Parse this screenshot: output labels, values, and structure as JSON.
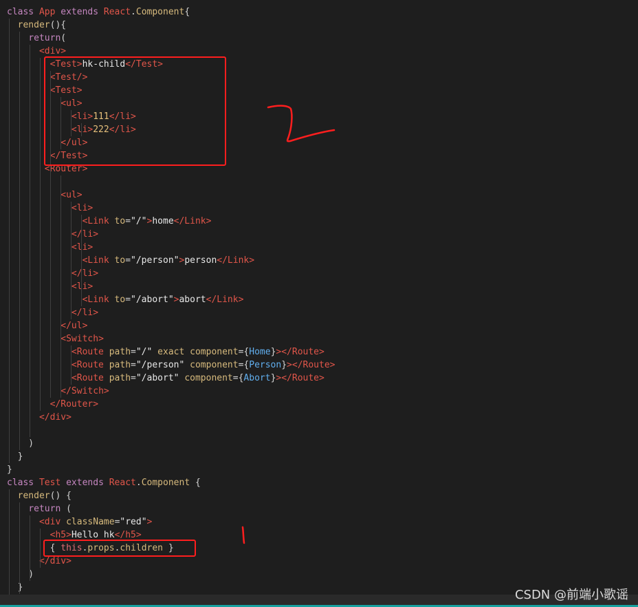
{
  "editor": {
    "language": "jsx",
    "lines": [
      [
        [
          "kw",
          "class "
        ],
        [
          "cls",
          "App "
        ],
        [
          "kw",
          "extends "
        ],
        [
          "cls",
          "React"
        ],
        [
          "br",
          "."
        ],
        [
          "fn",
          "Component"
        ],
        [
          "br",
          "{"
        ]
      ],
      [
        [
          "br",
          "  "
        ],
        [
          "fn",
          "render"
        ],
        [
          "br",
          "(){"
        ]
      ],
      [
        [
          "br",
          "    "
        ],
        [
          "kw",
          "return"
        ],
        [
          "br",
          "("
        ]
      ],
      [
        [
          "br",
          "      "
        ],
        [
          "tag",
          "<div>"
        ]
      ],
      [
        [
          "br",
          "        "
        ],
        [
          "tag",
          "<Test>"
        ],
        [
          "txt",
          "hk-child"
        ],
        [
          "tag",
          "</Test>"
        ]
      ],
      [
        [
          "br",
          "        "
        ],
        [
          "tag",
          "<Test/>"
        ]
      ],
      [
        [
          "br",
          "        "
        ],
        [
          "tag",
          "<Test>"
        ]
      ],
      [
        [
          "br",
          "          "
        ],
        [
          "tag",
          "<ul>"
        ]
      ],
      [
        [
          "br",
          "            "
        ],
        [
          "tag",
          "<li>"
        ],
        [
          "num",
          "111"
        ],
        [
          "tag",
          "</li>"
        ]
      ],
      [
        [
          "br",
          "            "
        ],
        [
          "tag",
          "<li>"
        ],
        [
          "num",
          "222"
        ],
        [
          "tag",
          "</li>"
        ]
      ],
      [
        [
          "br",
          "          "
        ],
        [
          "tag",
          "</ul>"
        ]
      ],
      [
        [
          "br",
          "        "
        ],
        [
          "tag",
          "</Test>"
        ]
      ],
      [
        [
          "br",
          "       "
        ],
        [
          "tag",
          "<Router>"
        ]
      ],
      [],
      [
        [
          "br",
          "          "
        ],
        [
          "tag",
          "<ul>"
        ]
      ],
      [
        [
          "br",
          "            "
        ],
        [
          "tag",
          "<li>"
        ]
      ],
      [
        [
          "br",
          "              "
        ],
        [
          "tag",
          "<Link "
        ],
        [
          "at",
          "to"
        ],
        [
          "br",
          "="
        ],
        [
          "str",
          "\"/\""
        ],
        [
          "tag",
          ">"
        ],
        [
          "txt",
          "home"
        ],
        [
          "tag",
          "</Link>"
        ]
      ],
      [
        [
          "br",
          "            "
        ],
        [
          "tag",
          "</li>"
        ]
      ],
      [
        [
          "br",
          "            "
        ],
        [
          "tag",
          "<li>"
        ]
      ],
      [
        [
          "br",
          "              "
        ],
        [
          "tag",
          "<Link "
        ],
        [
          "at",
          "to"
        ],
        [
          "br",
          "="
        ],
        [
          "str",
          "\"/person\""
        ],
        [
          "tag",
          ">"
        ],
        [
          "txt",
          "person"
        ],
        [
          "tag",
          "</Link>"
        ]
      ],
      [
        [
          "br",
          "            "
        ],
        [
          "tag",
          "</li>"
        ]
      ],
      [
        [
          "br",
          "            "
        ],
        [
          "tag",
          "<li>"
        ]
      ],
      [
        [
          "br",
          "              "
        ],
        [
          "tag",
          "<Link "
        ],
        [
          "at",
          "to"
        ],
        [
          "br",
          "="
        ],
        [
          "str",
          "\"/abort\""
        ],
        [
          "tag",
          ">"
        ],
        [
          "txt",
          "abort"
        ],
        [
          "tag",
          "</Link>"
        ]
      ],
      [
        [
          "br",
          "            "
        ],
        [
          "tag",
          "</li>"
        ]
      ],
      [
        [
          "br",
          "          "
        ],
        [
          "tag",
          "</ul>"
        ]
      ],
      [
        [
          "br",
          "          "
        ],
        [
          "tag",
          "<Switch>"
        ]
      ],
      [
        [
          "br",
          "            "
        ],
        [
          "tag",
          "<Route "
        ],
        [
          "at",
          "path"
        ],
        [
          "br",
          "="
        ],
        [
          "str",
          "\"/\" "
        ],
        [
          "at",
          "exact "
        ],
        [
          "at",
          "component"
        ],
        [
          "br",
          "={"
        ],
        [
          "comp",
          "Home"
        ],
        [
          "br",
          "}"
        ],
        [
          "tag",
          "></Route>"
        ]
      ],
      [
        [
          "br",
          "            "
        ],
        [
          "tag",
          "<Route "
        ],
        [
          "at",
          "path"
        ],
        [
          "br",
          "="
        ],
        [
          "str",
          "\"/person\" "
        ],
        [
          "at",
          "component"
        ],
        [
          "br",
          "={"
        ],
        [
          "comp",
          "Person"
        ],
        [
          "br",
          "}"
        ],
        [
          "tag",
          "></Route>"
        ]
      ],
      [
        [
          "br",
          "            "
        ],
        [
          "tag",
          "<Route "
        ],
        [
          "at",
          "path"
        ],
        [
          "br",
          "="
        ],
        [
          "str",
          "\"/abort\" "
        ],
        [
          "at",
          "component"
        ],
        [
          "br",
          "={"
        ],
        [
          "comp",
          "Abort"
        ],
        [
          "br",
          "}"
        ],
        [
          "tag",
          "></Route>"
        ]
      ],
      [
        [
          "br",
          "          "
        ],
        [
          "tag",
          "</Switch>"
        ]
      ],
      [
        [
          "br",
          "        "
        ],
        [
          "tag",
          "</Router>"
        ]
      ],
      [
        [
          "br",
          "      "
        ],
        [
          "tag",
          "</div>"
        ]
      ],
      [],
      [
        [
          "br",
          "    )"
        ]
      ],
      [
        [
          "br",
          "  }"
        ]
      ],
      [
        [
          "br",
          "}"
        ]
      ],
      [
        [
          "kw",
          "class "
        ],
        [
          "cls",
          "Test "
        ],
        [
          "kw",
          "extends "
        ],
        [
          "cls",
          "React"
        ],
        [
          "br",
          "."
        ],
        [
          "fn",
          "Component "
        ],
        [
          "br",
          "{"
        ]
      ],
      [
        [
          "br",
          "  "
        ],
        [
          "fn",
          "render"
        ],
        [
          "br",
          "() {"
        ]
      ],
      [
        [
          "br",
          "    "
        ],
        [
          "kw",
          "return "
        ],
        [
          "br",
          "("
        ]
      ],
      [
        [
          "br",
          "      "
        ],
        [
          "tag",
          "<div "
        ],
        [
          "at",
          "className"
        ],
        [
          "br",
          "="
        ],
        [
          "str",
          "\"red\""
        ],
        [
          "tag",
          ">"
        ]
      ],
      [
        [
          "br",
          "        "
        ],
        [
          "tag",
          "<h5>"
        ],
        [
          "txt",
          "Hello hk"
        ],
        [
          "tag",
          "</h5>"
        ]
      ],
      [
        [
          "br",
          "        { "
        ],
        [
          "var",
          "this"
        ],
        [
          "br",
          "."
        ],
        [
          "at",
          "props"
        ],
        [
          "br",
          "."
        ],
        [
          "at",
          "children "
        ],
        [
          "br",
          "}"
        ]
      ],
      [
        [
          "br",
          "      "
        ],
        [
          "tag",
          "</div>"
        ]
      ],
      [
        [
          "br",
          "    )"
        ]
      ],
      [
        [
          "br",
          "  }"
        ]
      ],
      [
        [
          "br",
          "}"
        ]
      ]
    ]
  },
  "colors": {
    "background": "#1e1e1e",
    "annotation": "#ff1e1e",
    "tag": "#e2564a",
    "keyword": "#c586c0",
    "attribute": "#d7ba7d"
  },
  "watermark": "CSDN @前端小歌谣"
}
